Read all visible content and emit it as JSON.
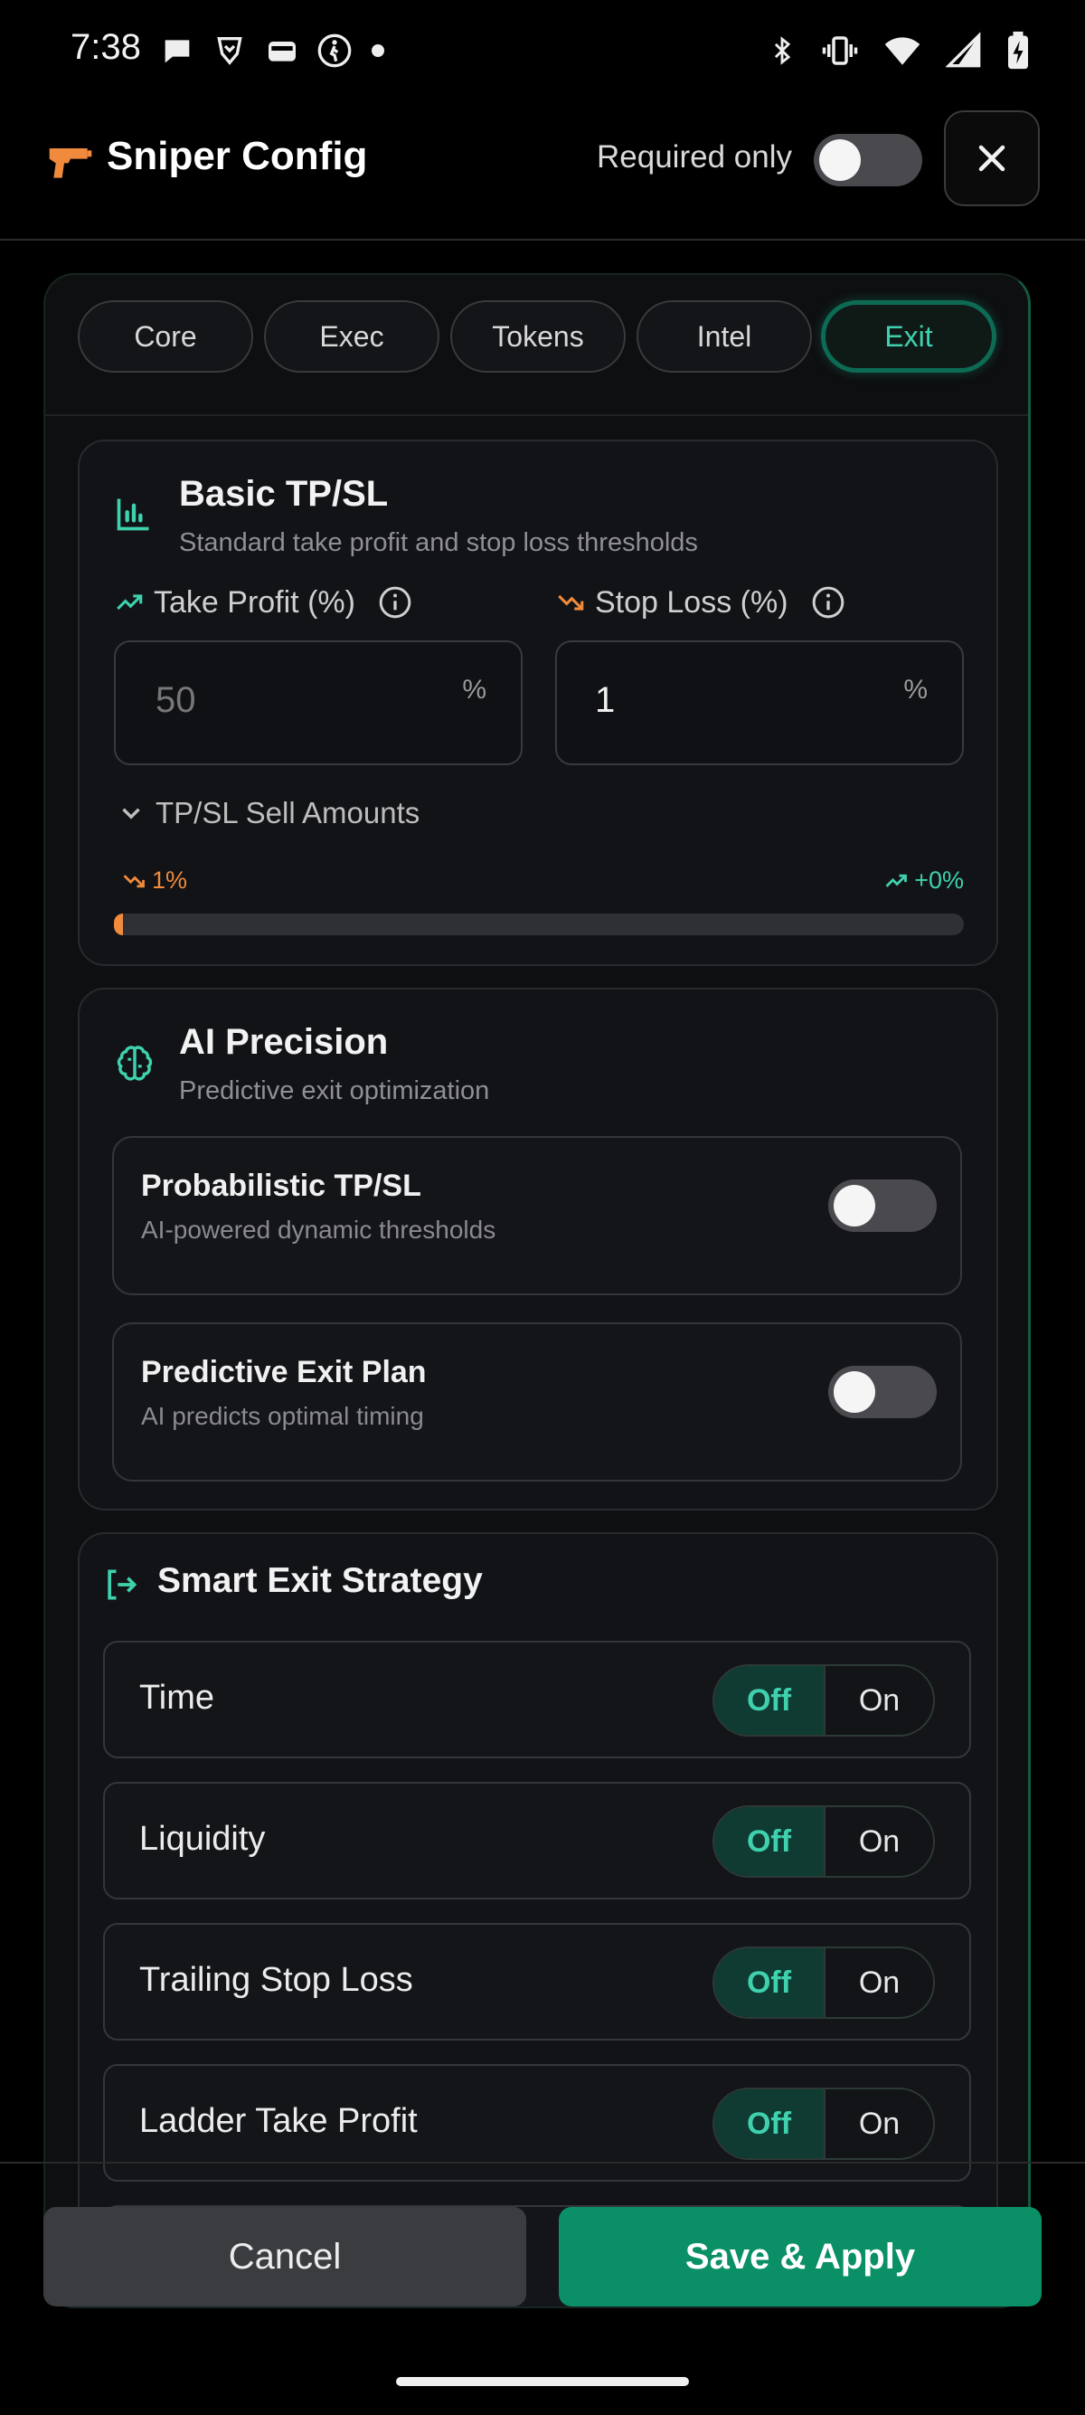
{
  "status_bar": {
    "time": "7:38"
  },
  "header": {
    "title": "Sniper Config",
    "required_only_label": "Required only",
    "required_only_on": false
  },
  "tabs": [
    {
      "label": "Core",
      "active": false
    },
    {
      "label": "Exec",
      "active": false
    },
    {
      "label": "Tokens",
      "active": false
    },
    {
      "label": "Intel",
      "active": false
    },
    {
      "label": "Exit",
      "active": true
    }
  ],
  "basic": {
    "title": "Basic TP/SL",
    "subtitle": "Standard take profit and stop loss thresholds",
    "take_profit_label": "Take Profit (%)",
    "take_profit_placeholder": "50",
    "stop_loss_label": "Stop Loss (%)",
    "stop_loss_value": "1",
    "unit": "%",
    "sell_amounts_label": "TP/SL Sell Amounts",
    "range_left": "1%",
    "range_right": "+0%"
  },
  "ai": {
    "title": "AI Precision",
    "subtitle": "Predictive exit optimization",
    "items": [
      {
        "title": "Probabilistic TP/SL",
        "desc": "AI-powered dynamic thresholds",
        "on": false
      },
      {
        "title": "Predictive Exit Plan",
        "desc": "AI predicts optimal timing",
        "on": false
      }
    ]
  },
  "smart": {
    "title": "Smart Exit Strategy",
    "off_label": "Off",
    "on_label": "On",
    "rows": [
      {
        "label": "Time"
      },
      {
        "label": "Liquidity"
      },
      {
        "label": "Trailing Stop Loss"
      },
      {
        "label": "Ladder Take Profit"
      }
    ]
  },
  "footer": {
    "cancel_label": "Cancel",
    "save_label": "Save & Apply"
  },
  "colors": {
    "accent": "#3fd1ad",
    "save_bg": "#0a8f66",
    "warning": "#f08a3c"
  }
}
